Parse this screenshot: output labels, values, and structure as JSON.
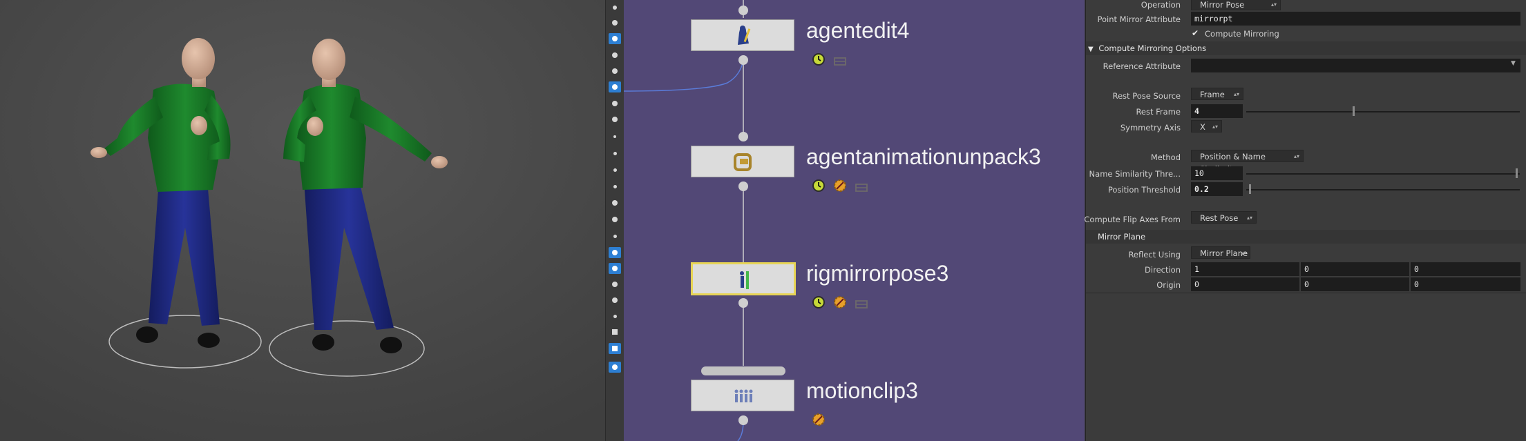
{
  "network": {
    "nodes": [
      {
        "name": "agentedit4"
      },
      {
        "name": "agentanimationunpack3"
      },
      {
        "name": "rigmirrorpose3"
      },
      {
        "name": "motionclip3"
      }
    ]
  },
  "params": {
    "operation": {
      "label": "Operation",
      "value": "Mirror Pose"
    },
    "point_mirror_attribute": {
      "label": "Point Mirror Attribute",
      "value": "mirrorpt"
    },
    "compute_mirroring": {
      "label": "Compute Mirroring",
      "checked": true
    },
    "compute_mirroring_options": {
      "title": "Compute Mirroring Options",
      "expanded": true
    },
    "reference_attribute": {
      "label": "Reference Attribute",
      "value": ""
    },
    "rest_pose_source": {
      "label": "Rest Pose Source",
      "value": "Frame"
    },
    "rest_frame": {
      "label": "Rest Frame",
      "value": "4"
    },
    "symmetry_axis": {
      "label": "Symmetry Axis",
      "value": "X"
    },
    "method": {
      "label": "Method",
      "value": "Position & Name Similarity"
    },
    "name_similarity_threshold": {
      "label": "Name Similarity Thre...",
      "value": "10"
    },
    "position_threshold": {
      "label": "Position Threshold",
      "value": "0.2"
    },
    "compute_flip_axes_from": {
      "label": "Compute Flip Axes From",
      "value": "Rest Pose"
    },
    "mirror_plane_section": {
      "title": "Mirror Plane"
    },
    "reflect_using": {
      "label": "Reflect Using",
      "value": "Mirror Plane"
    },
    "direction": {
      "label": "Direction",
      "x": "1",
      "y": "0",
      "z": "0"
    },
    "origin": {
      "label": "Origin",
      "x": "0",
      "y": "0",
      "z": "0"
    }
  },
  "colors": {
    "network_bg": "#524876",
    "viewport_bg": "#4a4a4a",
    "selected_node": "#e7d456",
    "shirt": "#1d7a2a",
    "pants": "#1f2a86",
    "skin": "#d9b49c",
    "toolbar_active": "#2d7fd3"
  }
}
